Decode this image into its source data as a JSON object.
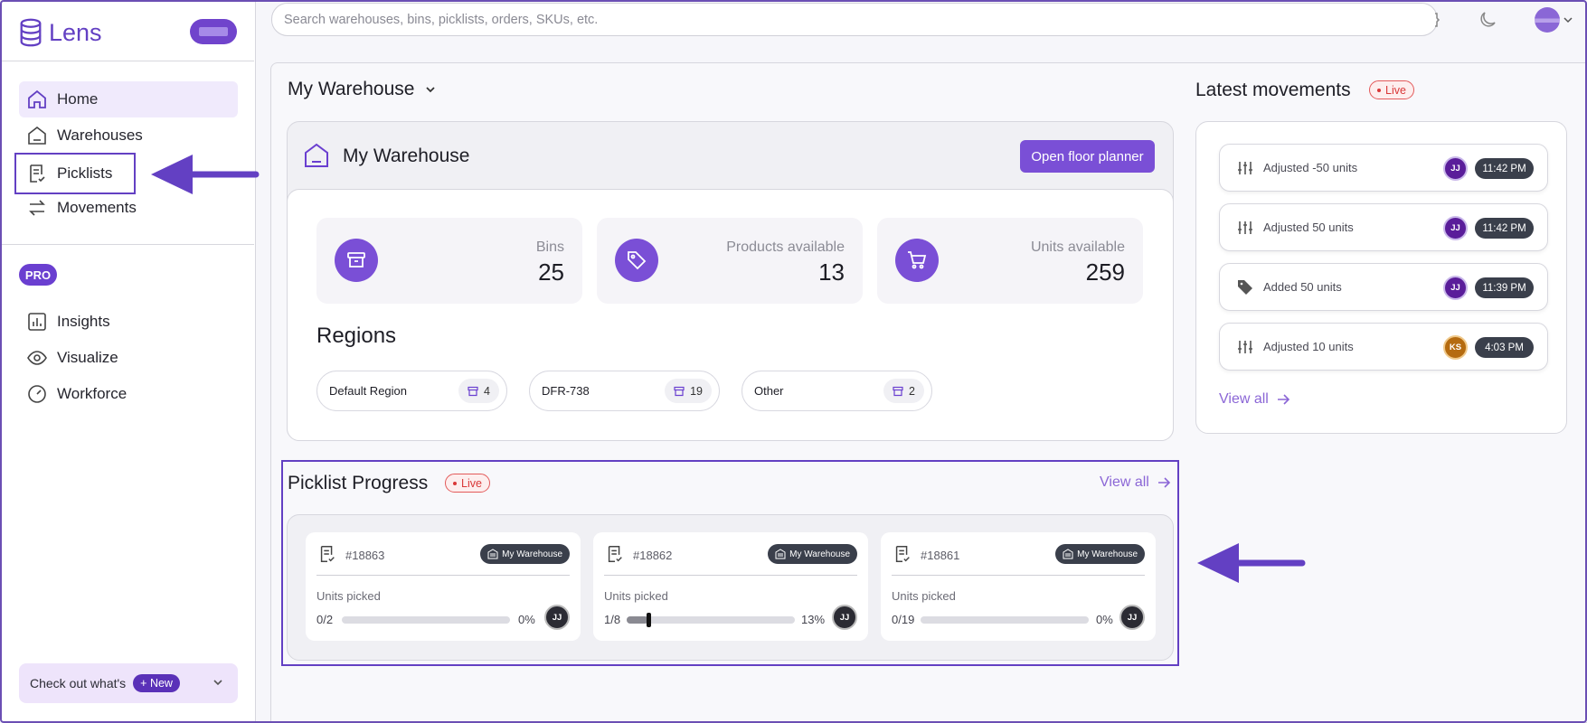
{
  "app": {
    "name": "Lens"
  },
  "sidebar": {
    "items": [
      {
        "label": "Home",
        "icon": "home-icon"
      },
      {
        "label": "Warehouses",
        "icon": "warehouse-icon"
      },
      {
        "label": "Picklists",
        "icon": "picklist-icon"
      },
      {
        "label": "Movements",
        "icon": "arrows-icon"
      }
    ],
    "pro_badge": "PRO",
    "pro_items": [
      {
        "label": "Insights",
        "icon": "chart-icon"
      },
      {
        "label": "Visualize",
        "icon": "eye-icon"
      },
      {
        "label": "Workforce",
        "icon": "gauge-icon"
      }
    ],
    "whats_new": {
      "label": "Check out what's",
      "badge": "+ New"
    }
  },
  "search": {
    "placeholder": "Search warehouses, bins, picklists, orders, SKUs, etc."
  },
  "warehouse": {
    "selector": "My Warehouse",
    "card_title": "My Warehouse",
    "open_floor_planner": "Open floor planner",
    "stats": [
      {
        "label": "Bins",
        "value": "25"
      },
      {
        "label": "Products available",
        "value": "13"
      },
      {
        "label": "Units available",
        "value": "259"
      }
    ],
    "regions_title": "Regions",
    "regions": [
      {
        "name": "Default Region",
        "count": "4"
      },
      {
        "name": "DFR-738",
        "count": "19"
      },
      {
        "name": "Other",
        "count": "2"
      }
    ]
  },
  "latest_movements": {
    "title": "Latest movements",
    "live": "Live",
    "items": [
      {
        "text": "Adjusted -50 units",
        "user": "JJ",
        "time": "11:42 PM"
      },
      {
        "text": "Adjusted 50 units",
        "user": "JJ",
        "time": "11:42 PM"
      },
      {
        "text": "Added 50 units",
        "user": "JJ",
        "time": "11:39 PM"
      },
      {
        "text": "Adjusted 10 units",
        "user": "KS",
        "time": "4:03 PM"
      }
    ],
    "view_all": "View all"
  },
  "picklist_progress": {
    "title": "Picklist Progress",
    "live": "Live",
    "view_all": "View all",
    "units_picked_label": "Units picked",
    "items": [
      {
        "id": "#18863",
        "warehouse": "My Warehouse",
        "count": "0/2",
        "percent": "0%",
        "progress": 0,
        "user": "JJ"
      },
      {
        "id": "#18862",
        "warehouse": "My Warehouse",
        "count": "1/8",
        "percent": "13%",
        "progress": 0.13,
        "user": "JJ"
      },
      {
        "id": "#18861",
        "warehouse": "My Warehouse",
        "count": "0/19",
        "percent": "0%",
        "progress": 0,
        "user": "JJ"
      }
    ]
  },
  "colors": {
    "accent": "#7a4fd6",
    "annotation": "#6340c3",
    "live": "#d93838"
  }
}
